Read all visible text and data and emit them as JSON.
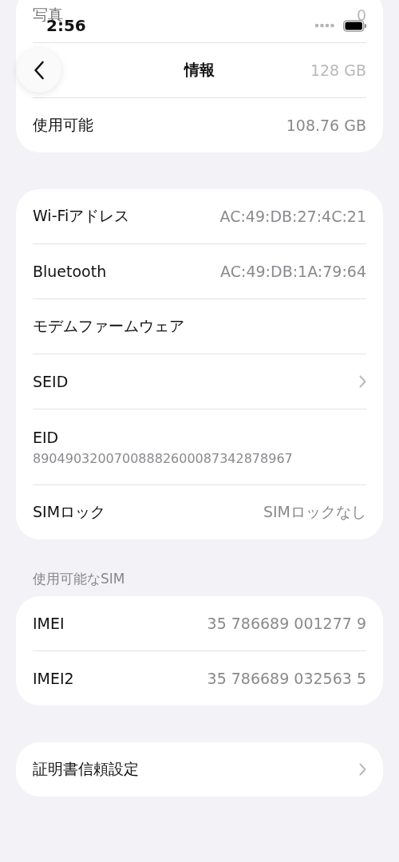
{
  "status_bar": {
    "time": "2:56"
  },
  "nav": {
    "title": "情報"
  },
  "sections": [
    {
      "rows": [
        {
          "kind": "value",
          "label": "写真",
          "value": "0",
          "faded": true
        },
        {
          "kind": "value",
          "value": "128 GB",
          "faded": true
        },
        {
          "kind": "value",
          "label": "使用可能",
          "value": "108.76 GB",
          "faded": false
        }
      ]
    },
    {
      "rows": [
        {
          "kind": "value",
          "label": "Wi-Fiアドレス",
          "value": "AC:49:DB:27:4C:21",
          "faded": false
        },
        {
          "kind": "value",
          "label": "Bluetooth",
          "value": "AC:49:DB:1A:79:64",
          "faded": false
        },
        {
          "kind": "value",
          "label": "モデムファームウェア",
          "faded": false
        },
        {
          "kind": "chevron",
          "label": "SEID",
          "faded": false
        },
        {
          "kind": "stacked",
          "label": "EID",
          "value": "89049032007008882600087342878967",
          "faded": false
        },
        {
          "kind": "value",
          "label": "SIMロック",
          "value": "SIMロックなし",
          "faded": false
        }
      ]
    },
    {
      "header": "使用可能なSIM",
      "rows": [
        {
          "kind": "value",
          "label": "IMEI",
          "value": "35 786689 001277 9",
          "faded": false
        },
        {
          "kind": "value",
          "label": "IMEI2",
          "value": "35 786689 032563 5",
          "faded": false
        }
      ]
    },
    {
      "rows": [
        {
          "kind": "chevron",
          "label": "証明書信頼設定",
          "faded": false
        }
      ]
    }
  ]
}
